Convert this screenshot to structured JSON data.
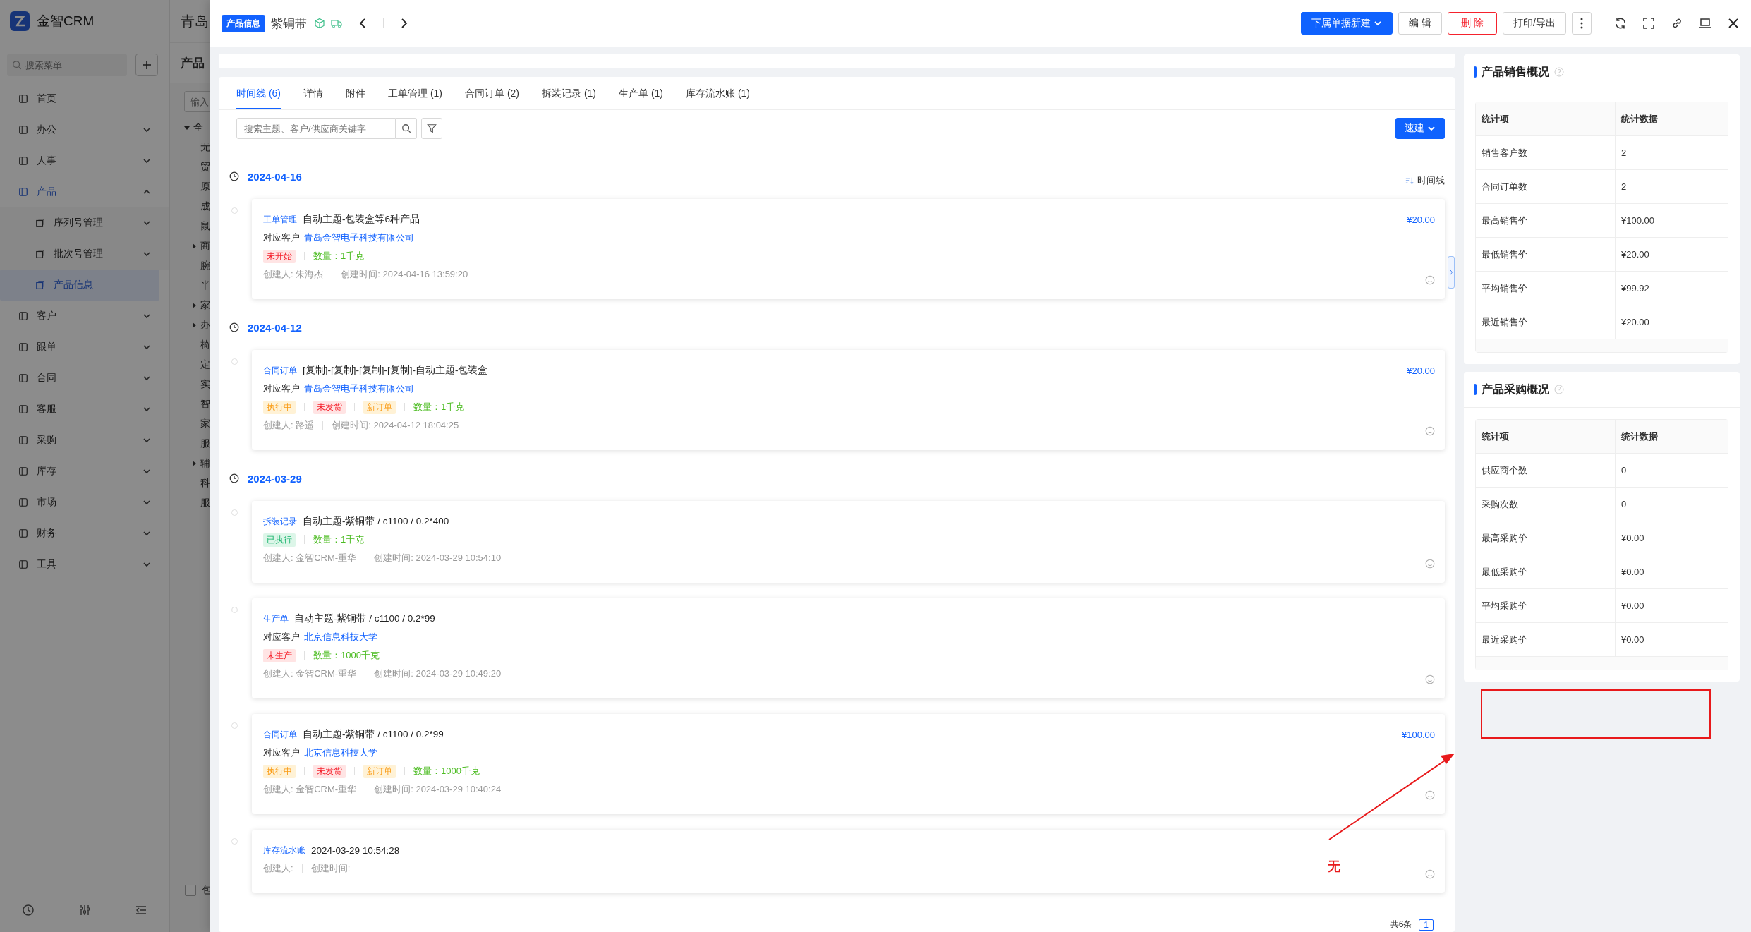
{
  "background": {
    "app": {
      "logo_text": "金智CRM",
      "search_placeholder": "搜索菜单"
    },
    "menu": [
      {
        "label": "首页",
        "selected": false
      },
      {
        "label": "办公",
        "expanded": false,
        "selected": false
      },
      {
        "label": "人事",
        "expanded": false,
        "selected": false
      },
      {
        "label": "产品",
        "expanded": true,
        "selected": true,
        "children": [
          {
            "label": "序列号管理",
            "expanded": false,
            "selected": false
          },
          {
            "label": "批次号管理",
            "expanded": false,
            "selected": false
          },
          {
            "label": "产品信息",
            "selected": true
          }
        ]
      },
      {
        "label": "客户",
        "expanded": false,
        "selected": false
      },
      {
        "label": "跟单",
        "expanded": false,
        "selected": false
      },
      {
        "label": "合同",
        "expanded": false,
        "selected": false
      },
      {
        "label": "客服",
        "expanded": false,
        "selected": false
      },
      {
        "label": "采购",
        "expanded": false,
        "selected": false
      },
      {
        "label": "库存",
        "expanded": false,
        "selected": false
      },
      {
        "label": "市场",
        "expanded": false,
        "selected": false
      },
      {
        "label": "财务",
        "expanded": false,
        "selected": false
      },
      {
        "label": "工具",
        "expanded": false,
        "selected": false
      }
    ],
    "page": {
      "breadcrumb": "青岛",
      "title": "产品",
      "filter_placeholder": "输入",
      "tree": [
        {
          "label": "全",
          "expanded": true,
          "children": [
            {
              "label": "无"
            },
            {
              "label": "贸"
            },
            {
              "label": "原"
            },
            {
              "label": "成"
            },
            {
              "label": "鼠"
            },
            {
              "label": "商",
              "expanded": false
            },
            {
              "label": "腕"
            },
            {
              "label": "半"
            },
            {
              "label": "家",
              "expanded": false
            },
            {
              "label": "办",
              "expanded": false
            },
            {
              "label": "椅"
            },
            {
              "label": "定"
            },
            {
              "label": "实"
            },
            {
              "label": "智"
            },
            {
              "label": "家"
            },
            {
              "label": "服"
            },
            {
              "label": "辅",
              "expanded": false
            },
            {
              "label": "科"
            },
            {
              "label": "服"
            }
          ]
        }
      ],
      "checkbox": {
        "label": "包",
        "checked": false
      }
    }
  },
  "drawer": {
    "badge": "产品信息",
    "title": "紫铜带",
    "actions": [
      {
        "label": "下属单据新建",
        "kind": "primary",
        "dropdown": true
      },
      {
        "label": "编 辑",
        "kind": "default",
        "dropdown": false
      },
      {
        "label": "删 除",
        "kind": "danger",
        "dropdown": false
      },
      {
        "label": "打印/导出",
        "kind": "default",
        "dropdown": false
      }
    ],
    "tabs": [
      {
        "label": "时间线 (6)",
        "selected": true
      },
      {
        "label": "详情",
        "selected": false
      },
      {
        "label": "附件",
        "selected": false
      },
      {
        "label": "工单管理 (1)",
        "selected": false
      },
      {
        "label": "合同订单 (2)",
        "selected": false
      },
      {
        "label": "拆装记录 (1)",
        "selected": false
      },
      {
        "label": "生产单 (1)",
        "selected": false
      },
      {
        "label": "库存流水账 (1)",
        "selected": false
      }
    ],
    "search": {
      "placeholder": "搜索主题、客户/供应商关键字"
    },
    "quick_create": "速建",
    "sort_label": "时间线",
    "timeline": [
      {
        "date": "2024-04-16",
        "entries": [
          {
            "type": "工单管理",
            "title": "自动主题-包装盒等6种产品",
            "customer_label": "对应客户",
            "customer": "青岛金智电子科技有限公司",
            "tags": [
              {
                "text": "未开始",
                "kind": "danger"
              }
            ],
            "quantity": "数量：1千克",
            "creator": "创建人: 朱海杰",
            "created": "创建时间: 2024-04-16 13:59:20",
            "amount": "¥20.00"
          }
        ]
      },
      {
        "date": "2024-04-12",
        "entries": [
          {
            "type": "合同订单",
            "title": "[复制]-[复制]-[复制]-[复制]-自动主题-包装盒",
            "customer_label": "对应客户",
            "customer": "青岛金智电子科技有限公司",
            "tags": [
              {
                "text": "执行中",
                "kind": "warning"
              },
              {
                "text": "未发货",
                "kind": "danger"
              },
              {
                "text": "新订单",
                "kind": "warning"
              }
            ],
            "quantity": "数量：1千克",
            "creator": "创建人: 路遥",
            "created": "创建时间: 2024-04-12 18:04:25",
            "amount": "¥20.00"
          }
        ]
      },
      {
        "date": "2024-03-29",
        "entries": [
          {
            "type": "拆装记录",
            "title": "自动主题-紫铜带 / c1100 / 0.2*400",
            "tags": [
              {
                "text": "已执行",
                "kind": "success"
              }
            ],
            "quantity": "数量：1千克",
            "creator": "创建人: 金智CRM-重华",
            "created": "创建时间: 2024-03-29 10:54:10"
          },
          {
            "type": "生产单",
            "title": "自动主题-紫铜带 / c1100 / 0.2*99",
            "customer_label": "对应客户",
            "customer": "北京信息科技大学",
            "tags": [
              {
                "text": "未生产",
                "kind": "danger"
              }
            ],
            "quantity": "数量：1000千克",
            "creator": "创建人: 金智CRM-重华",
            "created": "创建时间: 2024-03-29 10:49:20"
          },
          {
            "type": "合同订单",
            "title": "自动主题-紫铜带 / c1100 / 0.2*99",
            "customer_label": "对应客户",
            "customer": "北京信息科技大学",
            "tags": [
              {
                "text": "执行中",
                "kind": "warning"
              },
              {
                "text": "未发货",
                "kind": "danger"
              },
              {
                "text": "新订单",
                "kind": "warning"
              }
            ],
            "quantity": "数量：1000千克",
            "creator": "创建人: 金智CRM-重华",
            "created": "创建时间: 2024-03-29 10:40:24",
            "amount": "¥100.00"
          },
          {
            "type": "库存流水账",
            "title": "2024-03-29 10:54:28",
            "creator": "创建人:",
            "created": "创建时间:"
          }
        ]
      }
    ],
    "pagination": {
      "total": "共6条",
      "page": "1"
    },
    "panels": [
      {
        "title": "产品销售概况",
        "columns": [
          "统计项",
          "统计数据"
        ],
        "rows": [
          [
            "销售客户数",
            "2"
          ],
          [
            "合同订单数",
            "2"
          ],
          [
            "最高销售价",
            "¥100.00"
          ],
          [
            "最低销售价",
            "¥20.00"
          ],
          [
            "平均销售价",
            "¥99.92"
          ],
          [
            "最近销售价",
            "¥20.00"
          ]
        ]
      },
      {
        "title": "产品采购概况",
        "columns": [
          "统计项",
          "统计数据"
        ],
        "rows": [
          [
            "供应商个数",
            "0"
          ],
          [
            "采购次数",
            "0"
          ],
          [
            "最高采购价",
            "¥0.00"
          ],
          [
            "最低采购价",
            "¥0.00"
          ],
          [
            "平均采购价",
            "¥0.00"
          ],
          [
            "最近采购价",
            "¥0.00"
          ]
        ]
      }
    ]
  },
  "annotation": {
    "note": "无"
  }
}
